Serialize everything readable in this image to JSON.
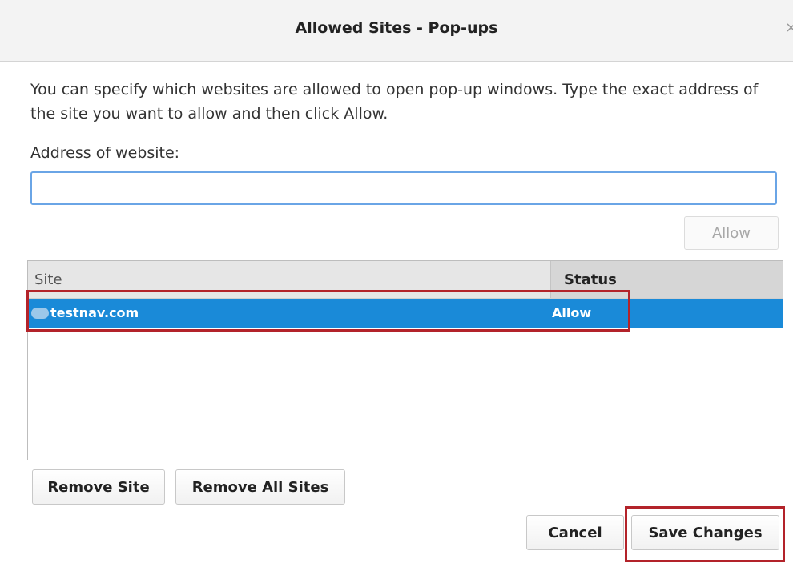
{
  "window": {
    "title": "Allowed Sites - Pop-ups",
    "close_glyph": "×"
  },
  "description": "You can specify which websites are allowed to open pop-up windows. Type the exact address of the site you want to allow and then click Allow.",
  "address": {
    "label": "Address of website:",
    "value": "",
    "placeholder": ""
  },
  "buttons": {
    "allow": "Allow",
    "remove_site": "Remove Site",
    "remove_all_sites": "Remove All Sites",
    "cancel": "Cancel",
    "save_changes": "Save Changes"
  },
  "table": {
    "columns": [
      "Site",
      "Status"
    ],
    "rows": [
      {
        "site": "testnav.com",
        "status": "Allow",
        "selected": true
      }
    ]
  },
  "colors": {
    "selection": "#1a8ad8",
    "annotation_highlight": "#b3232a",
    "input_focus": "#6aa5e6"
  },
  "annotations": [
    "highlight-selected-row",
    "highlight-save-changes"
  ]
}
